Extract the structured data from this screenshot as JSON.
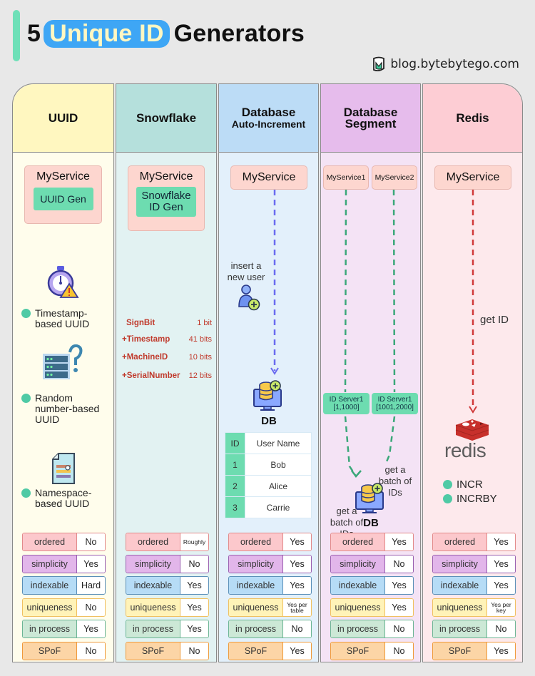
{
  "title": {
    "prefix": "5",
    "highlight": "Unique ID",
    "suffix": "Generators"
  },
  "brand": {
    "icon": "bytebytego-logo-icon",
    "text": "blog.bytebytego.com"
  },
  "colors": {
    "accent_bar": "#6ee0b8",
    "title_highlight_bg": "#3ea6f5",
    "title_highlight_text": "#fff7c2",
    "service_box": "#fdd6cf",
    "generator_box": "#6ddcb0",
    "snowflake_bits_text": "#c0392b",
    "db_arrow": "#6b6bf0",
    "segment_arrow": "#3aa879",
    "redis_arrow": "#d03a3a"
  },
  "columns": [
    {
      "header": "UUID",
      "service": "MyService",
      "generator": "UUID Gen",
      "variants": [
        {
          "icon": "stopwatch-warning-icon",
          "label": "Timestamp-based UUID"
        },
        {
          "icon": "server-question-icon",
          "label": "Random number-based UUID"
        },
        {
          "icon": "document-icon",
          "label": "Namespace-based UUID"
        }
      ],
      "comparison": {
        "ordered": "No",
        "simplicity": "Yes",
        "indexable": "Hard",
        "uniqueness": "No",
        "in_process": "Yes",
        "spof": "No"
      }
    },
    {
      "header": "Snowflake",
      "service": "MyService",
      "generator": "Snowflake ID Gen",
      "bit_layout": [
        {
          "name": "SignBit",
          "bits": "1 bit"
        },
        {
          "name": "+Timestamp",
          "bits": "41 bits"
        },
        {
          "name": "+MachineID",
          "bits": "10 bits"
        },
        {
          "name": "+SerialNumber",
          "bits": "12 bits"
        }
      ],
      "comparison": {
        "ordered": "Roughly",
        "simplicity": "No",
        "indexable": "Yes",
        "uniqueness": "Yes",
        "in_process": "Yes",
        "spof": "No"
      }
    },
    {
      "header": "Database",
      "header_sub": "Auto-Increment",
      "service": "MyService",
      "arrow_label": "insert a new user",
      "user_icon": "add-user-icon",
      "db_icon": "database-add-icon",
      "db_label": "DB",
      "table": {
        "headers": [
          "ID",
          "User Name"
        ],
        "rows": [
          [
            "1",
            "Bob"
          ],
          [
            "2",
            "Alice"
          ],
          [
            "3",
            "Carrie"
          ]
        ]
      },
      "comparison": {
        "ordered": "Yes",
        "simplicity": "Yes",
        "indexable": "Yes",
        "uniqueness": "Yes per table",
        "in_process": "No",
        "spof": "Yes"
      }
    },
    {
      "header": "Database",
      "header_sub": "Segment",
      "services": [
        "MyService1",
        "MyService2"
      ],
      "id_servers": [
        {
          "name": "ID Server1",
          "range": "[1,1000]"
        },
        {
          "name": "ID Server1",
          "range": "[1001,2000]"
        }
      ],
      "arrow_labels": [
        "get a batch of IDs",
        "get a batch of IDs"
      ],
      "db_icon": "database-add-icon",
      "db_label": "DB",
      "comparison": {
        "ordered": "Yes",
        "simplicity": "No",
        "indexable": "Yes",
        "uniqueness": "Yes",
        "in_process": "No",
        "spof": "No"
      }
    },
    {
      "header": "Redis",
      "service": "MyService",
      "arrow_label": "get ID",
      "logo_icon": "redis-logo-icon",
      "logo_text": "redis",
      "commands": [
        "INCR",
        "INCRBY"
      ],
      "comparison": {
        "ordered": "Yes",
        "simplicity": "Yes",
        "indexable": "Yes",
        "uniqueness": "Yes per key",
        "in_process": "No",
        "spof": "Yes"
      }
    }
  ],
  "comparison_labels": {
    "ordered": "ordered",
    "simplicity": "simplicity",
    "indexable": "indexable",
    "uniqueness": "uniqueness",
    "in_process": "in process",
    "spof": "SPoF"
  }
}
